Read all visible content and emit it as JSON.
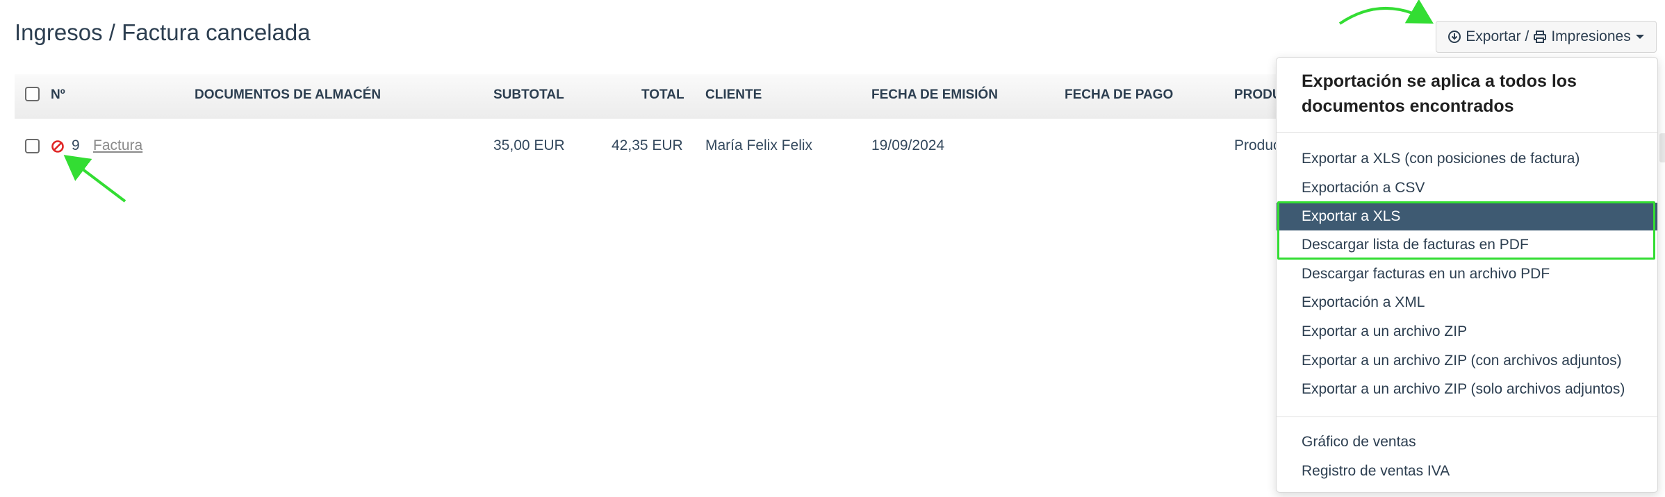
{
  "page": {
    "title": "Ingresos / Factura cancelada"
  },
  "toolbar": {
    "export_label": "Exportar /",
    "print_label": "Impresiones",
    "icons": [
      "download-circle-icon",
      "printer-icon",
      "caret-down-icon"
    ]
  },
  "table": {
    "columns": {
      "number": "Nº",
      "warehouse_docs": "DOCUMENTOS DE ALMACÉN",
      "subtotal": "SUBTOTAL",
      "total": "TOTAL",
      "client": "CLIENTE",
      "issue_date": "FECHA DE EMISIÓN",
      "payment_date": "FECHA DE PAGO",
      "product": "PRODU"
    },
    "rows": [
      {
        "status_icon": "cancelled-icon",
        "number": "9",
        "doc_type": "Factura",
        "subtotal": "35,00 EUR",
        "total": "42,35 EUR",
        "client": "María Felix Felix",
        "issue_date": "19/09/2024",
        "payment_date": "",
        "product": "Produc"
      }
    ]
  },
  "menu": {
    "header": "Exportación se aplica a todos los documentos encontrados",
    "items": [
      "Exportar a XLS (con posiciones de factura)",
      "Exportación a CSV",
      "Exportar a XLS",
      "Descargar lista de facturas en PDF",
      "Descargar facturas en un archivo PDF",
      "Exportación a XML",
      "Exportar a un archivo ZIP",
      "Exportar a un archivo ZIP (con archivos adjuntos)",
      "Exportar a un archivo ZIP (solo archivos adjuntos)"
    ],
    "reports": [
      "Gráfico de ventas",
      "Registro de ventas IVA"
    ],
    "active_index": 2
  },
  "colors": {
    "accent_highlight": "#33dd33",
    "active_item_bg": "#3e5a72",
    "cancel_icon": "#e02424"
  }
}
